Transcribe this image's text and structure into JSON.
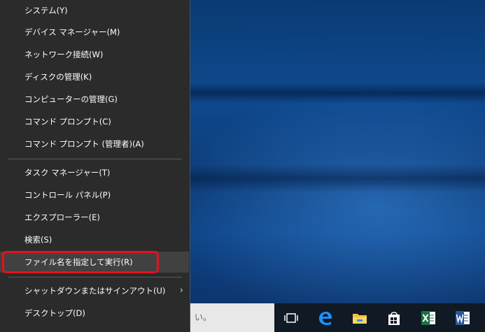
{
  "menu": {
    "items": [
      {
        "label": "システム(Y)"
      },
      {
        "label": "デバイス マネージャー(M)"
      },
      {
        "label": "ネットワーク接続(W)"
      },
      {
        "label": "ディスクの管理(K)"
      },
      {
        "label": "コンピューターの管理(G)"
      },
      {
        "label": "コマンド プロンプト(C)"
      },
      {
        "label": "コマンド プロンプト (管理者)(A)"
      },
      {
        "label": "タスク マネージャー(T)"
      },
      {
        "label": "コントロール パネル(P)"
      },
      {
        "label": "エクスプローラー(E)"
      },
      {
        "label": "検索(S)"
      },
      {
        "label": "ファイル名を指定して実行(R)"
      },
      {
        "label": "シャットダウンまたはサインアウト(U)",
        "submenu_glyph": "›"
      },
      {
        "label": "デスクトップ(D)"
      }
    ],
    "highlight_color": "#e8101c"
  },
  "taskbar": {
    "search_text": "い。",
    "icons": [
      "task-view-icon",
      "edge-icon",
      "file-explorer-icon",
      "store-icon",
      "excel-icon",
      "word-icon"
    ]
  }
}
